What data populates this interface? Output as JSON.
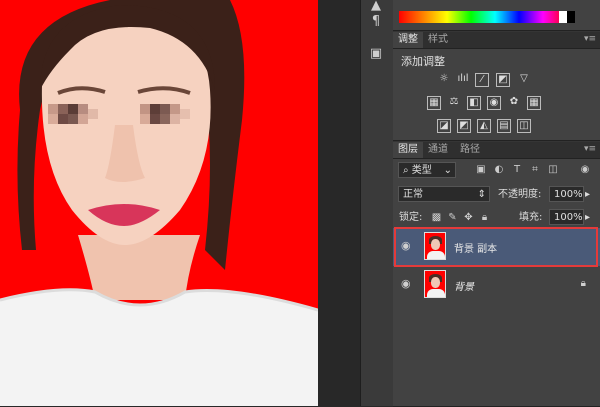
{
  "panels": {
    "adjustments": {
      "tabs": [
        "调整",
        "样式"
      ],
      "title": "添加调整"
    },
    "layers": {
      "tabs": [
        "图层",
        "通道",
        "路径"
      ],
      "filter_kind": "类型",
      "blend_mode": "正常",
      "opacity_label": "不透明度:",
      "opacity_value": "100%",
      "lock_label": "锁定:",
      "fill_label": "填充:",
      "fill_value": "100%",
      "items": [
        {
          "name": "背景 副本",
          "selected": true
        },
        {
          "name": "背景",
          "selected": false,
          "locked": true
        }
      ]
    }
  },
  "colors": {
    "canvas_background": "#ff0000",
    "selection_highlight": "#e43a3a",
    "selected_layer_bg": "#4a5a78"
  },
  "icons": {
    "toolstrip": [
      "arrow-tool-icon",
      "paragraph-icon",
      "properties-icon"
    ]
  }
}
